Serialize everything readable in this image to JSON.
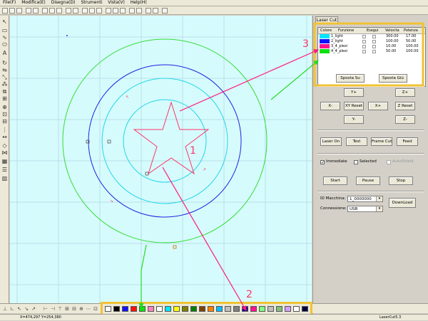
{
  "menu": [
    "File(F)",
    "Modifica(E)",
    "Disegna(D)",
    "Strumenti",
    "Vista(V)",
    "Help(H)"
  ],
  "panel": {
    "tab": "Laser Cut",
    "layers_header": {
      "color": "Colore",
      "function": "Funzione",
      "exec": "Esegui",
      "speed": "Velocita",
      "power": "Potenza"
    },
    "layers": [
      {
        "color": "#00e6ff",
        "name": "1_light",
        "speed": "300.00",
        "power": "17.00"
      },
      {
        "color": "#1010ff",
        "name": "2_light",
        "speed": "100.00",
        "power": "50.00"
      },
      {
        "color": "#ff1090",
        "name": "3_4_plexi",
        "speed": "10.00",
        "power": "100.00"
      },
      {
        "color": "#10e010",
        "name": "4_4_plexi",
        "speed": "50.00",
        "power": "100.00"
      }
    ],
    "move_up": "Sposta Su",
    "move_down": "Sposta Giù",
    "jog": {
      "y_plus": "Y+",
      "z_plus": "Z+",
      "x_minus": "X-",
      "xy_reset": "XY Reset",
      "x_plus": "X+",
      "z_reset": "Z Reset",
      "y_minus": "Y-",
      "z_minus": "Z-"
    },
    "laser_on": "Laser On",
    "test": "Test",
    "frame_cut": "Frame Cut",
    "feed": "Feed",
    "immediate": "Immediate",
    "selected": "Selected",
    "autoinsert": "AutoShield",
    "start": "Start",
    "pause": "Pause",
    "stop": "Stop",
    "machine_id_label": "ID Macchina:",
    "machine_id_value": "1_0000000",
    "connection_label": "Connessione:",
    "connection_value": "USB",
    "download": "DownLoad"
  },
  "annotations": {
    "one": "1",
    "two": "2",
    "three": "3"
  },
  "palette": [
    "#ffffff",
    "#000000",
    "#1010ff",
    "#ff1010",
    "#10e010",
    "#ff80c0",
    "#ffffff",
    "#00e6ff",
    "#ffff00",
    "#808000",
    "#008000",
    "#804000",
    "#ff8000",
    "#00c0ff",
    "#c0c0c0",
    "#808080",
    "#0000a0",
    "#ff1090",
    "#80ff80",
    "#c0c0c0",
    "#80c080",
    "#d0a0ff",
    "#ffffff",
    "#000040"
  ],
  "status": {
    "coords": "X=474,297 Y=254,380",
    "app": "LaserCut5.3"
  },
  "colors": {
    "canvas": "#d6fbfd",
    "highlight": "#f2c233",
    "arrow_pink": "#ff1a7a",
    "arrow_green": "#22dd22",
    "star": "#ff3366"
  }
}
